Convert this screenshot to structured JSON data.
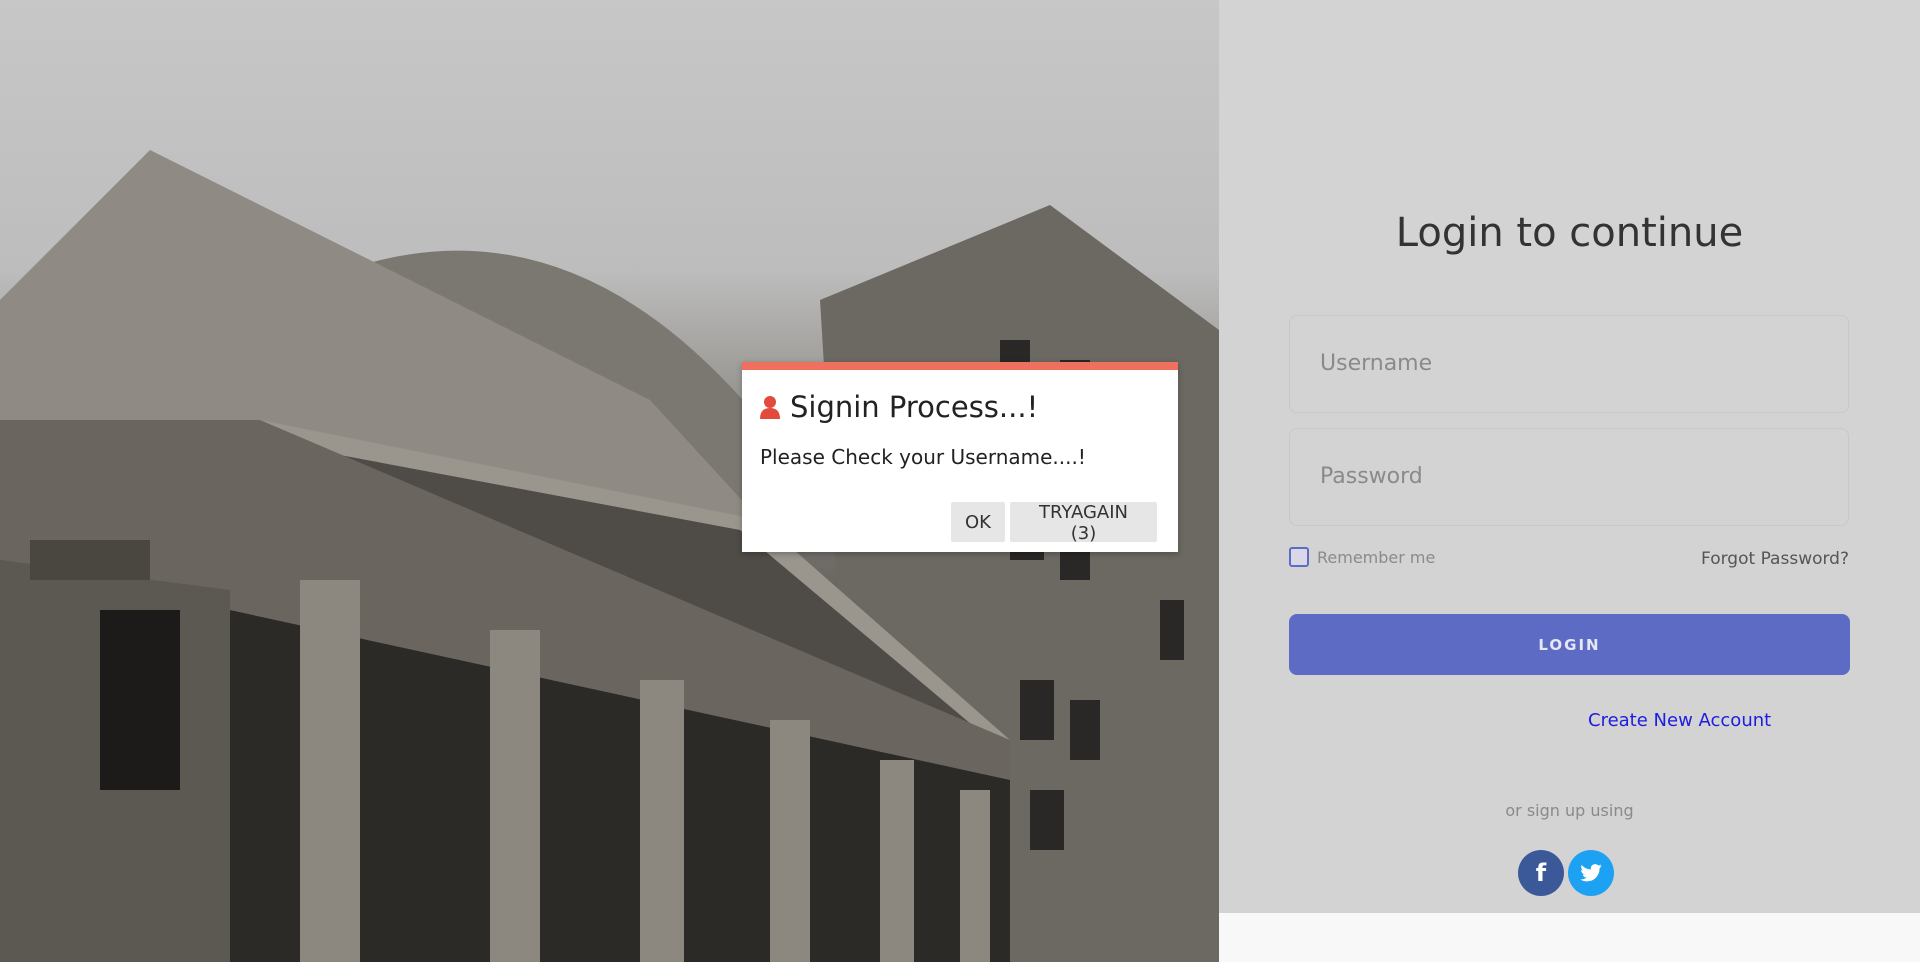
{
  "login": {
    "title": "Login to continue",
    "username_placeholder": "Username",
    "password_placeholder": "Password",
    "remember_label": "Remember me",
    "forgot_label": "Forgot Password?",
    "login_label": "LOGIN",
    "create_label": "Create New Account",
    "social_label": "or sign up using",
    "facebook_icon": "f",
    "twitter_icon": "twitter-bird"
  },
  "dialog": {
    "title": "Signin Process...!",
    "message": "Please Check your Username....!",
    "ok_label": "OK",
    "tryagain_label": "TRYAGAIN (3)",
    "accent_color": "#f0705f",
    "icon": "user-icon"
  },
  "colors": {
    "primary_button": "#5e6bc4",
    "link": "#1d1de0",
    "facebook": "#3b5998",
    "twitter": "#1da1f2"
  }
}
